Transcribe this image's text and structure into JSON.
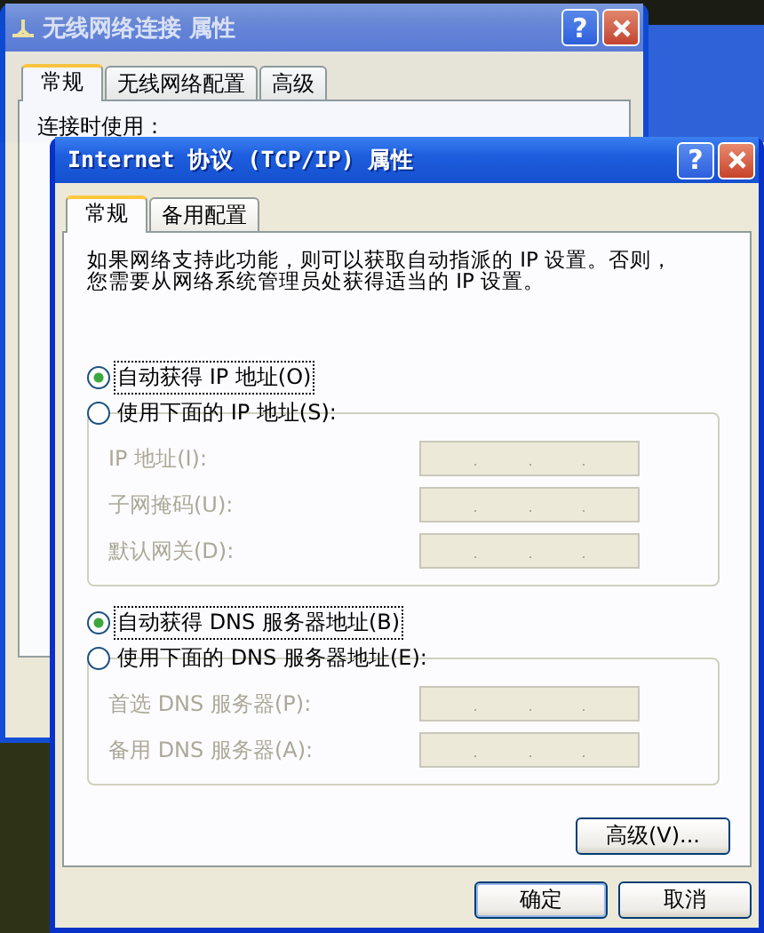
{
  "background_window": {
    "title": "无线网络连接 属性",
    "help": "?",
    "tabs": [
      {
        "label": "常规",
        "selected": true
      },
      {
        "label": "无线网络配置",
        "selected": false
      },
      {
        "label": "高级",
        "selected": false
      }
    ],
    "label": "连接时使用："
  },
  "window": {
    "title": "Internet 协议 (TCP/IP) 属性",
    "help": "?",
    "tabs": [
      {
        "label": "常规",
        "selected": true
      },
      {
        "label": "备用配置",
        "selected": false
      }
    ],
    "description": "如果网络支持此功能，则可以获取自动指派的 IP 设置。否则，您需要从网络系统管理员处获得适当的 IP 设置。",
    "ip_options": [
      {
        "label": "自动获得 IP 地址(O)",
        "selected": true
      },
      {
        "label": "使用下面的 IP 地址(S):",
        "selected": false
      }
    ],
    "ip_fields": [
      {
        "label": "IP 地址(I):",
        "disabled": true
      },
      {
        "label": "子网掩码(U):",
        "disabled": true
      },
      {
        "label": "默认网关(D):",
        "disabled": true
      }
    ],
    "dns_options": [
      {
        "label": "自动获得 DNS 服务器地址(B)",
        "selected": true
      },
      {
        "label": "使用下面的 DNS 服务器地址(E):",
        "selected": false
      }
    ],
    "dns_fields": [
      {
        "label": "首选 DNS 服务器(P):",
        "disabled": true
      },
      {
        "label": "备用 DNS 服务器(A):",
        "disabled": true
      }
    ],
    "advanced_button": "高级(V)...",
    "buttons": [
      "确定",
      "取消"
    ]
  }
}
